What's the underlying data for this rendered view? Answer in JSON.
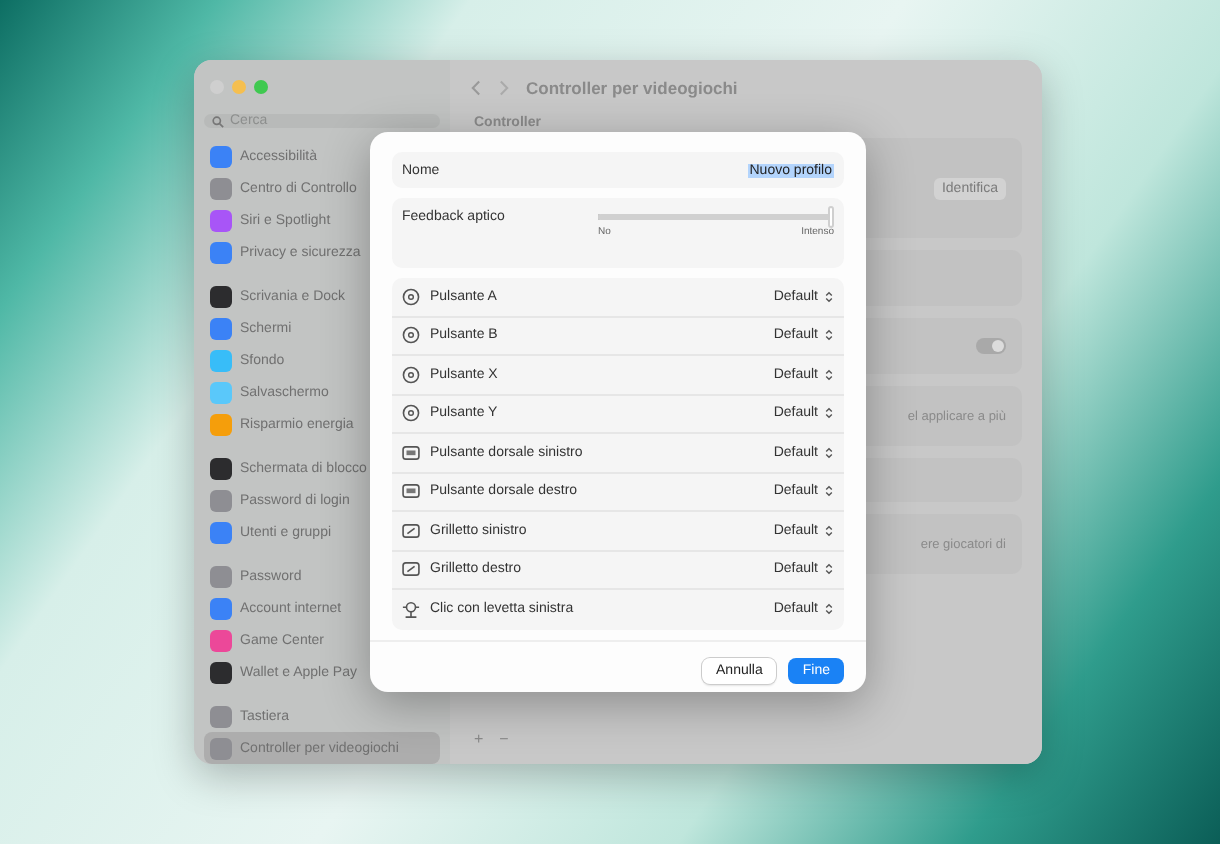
{
  "window": {
    "title": "Controller per videogiochi"
  },
  "sidebar": {
    "search": {
      "placeholder": "Cerca"
    },
    "groups": [
      [
        {
          "label": "Accessibilità",
          "color": "#3b82f6",
          "selected": false
        },
        {
          "label": "Centro di Controllo",
          "color": "#8e8e93",
          "selected": false
        },
        {
          "label": "Siri e Spotlight",
          "color": "#a855f7",
          "selected": false
        },
        {
          "label": "Privacy e sicurezza",
          "color": "#3b82f6",
          "selected": false
        }
      ],
      [
        {
          "label": "Scrivania e Dock",
          "color": "#2c2c2e",
          "selected": false
        },
        {
          "label": "Schermi",
          "color": "#3b82f6",
          "selected": false
        },
        {
          "label": "Sfondo",
          "color": "#38bdf8",
          "selected": false
        },
        {
          "label": "Salvaschermo",
          "color": "#5ac8fa",
          "selected": false
        },
        {
          "label": "Risparmio energia",
          "color": "#f59e0b",
          "selected": false
        }
      ],
      [
        {
          "label": "Schermata di blocco",
          "color": "#2c2c2e",
          "selected": false
        },
        {
          "label": "Password di login",
          "color": "#8e8e93",
          "selected": false
        },
        {
          "label": "Utenti e gruppi",
          "color": "#3b82f6",
          "selected": false
        }
      ],
      [
        {
          "label": "Password",
          "color": "#8e8e93",
          "selected": false
        },
        {
          "label": "Account internet",
          "color": "#3b82f6",
          "selected": false
        },
        {
          "label": "Game Center",
          "color": "#ec4899",
          "selected": false
        },
        {
          "label": "Wallet e Apple Pay",
          "color": "#2c2c2e",
          "selected": false
        }
      ],
      [
        {
          "label": "Tastiera",
          "color": "#8e8e93",
          "selected": false
        },
        {
          "label": "Controller per videogiochi",
          "color": "#8e8e93",
          "selected": true
        }
      ]
    ]
  },
  "content": {
    "section": "Controller",
    "identify_button": "Identifica",
    "toggle": {
      "on": true
    },
    "note_1": "el applicare a più",
    "note_2": "ere giocatori di",
    "add": "+",
    "remove": "−"
  },
  "dialog": {
    "name": {
      "label": "Nome",
      "value": "Nuovo profilo"
    },
    "feedback": {
      "label": "Feedback aptico",
      "level": 1,
      "min_label": "No",
      "max_label": "Intenso"
    },
    "mappings": [
      {
        "kind": "face",
        "label": "Pulsante A",
        "value": "Default"
      },
      {
        "kind": "face",
        "label": "Pulsante B",
        "value": "Default"
      },
      {
        "kind": "face",
        "label": "Pulsante X",
        "value": "Default"
      },
      {
        "kind": "face",
        "label": "Pulsante Y",
        "value": "Default"
      },
      {
        "kind": "shoulder",
        "label": "Pulsante dorsale sinistro",
        "value": "Default"
      },
      {
        "kind": "shoulder",
        "label": "Pulsante dorsale destro",
        "value": "Default"
      },
      {
        "kind": "trigger",
        "label": "Grilletto sinistro",
        "value": "Default"
      },
      {
        "kind": "trigger",
        "label": "Grilletto destro",
        "value": "Default"
      },
      {
        "kind": "stick",
        "label": "Clic con levetta sinistra",
        "value": "Default"
      }
    ],
    "buttons": {
      "cancel": "Annulla",
      "done": "Fine"
    }
  }
}
